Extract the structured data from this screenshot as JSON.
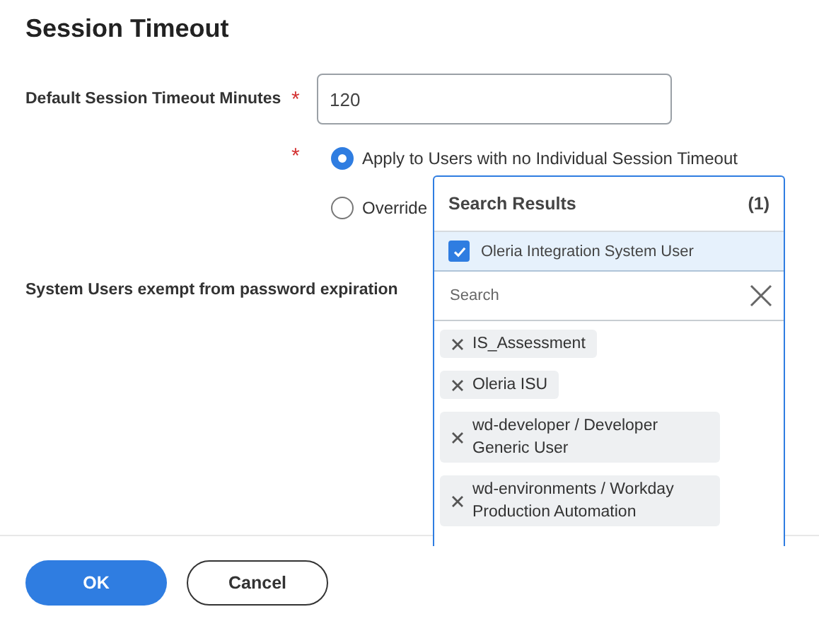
{
  "title": "Session Timeout",
  "timeout_field": {
    "label": "Default Session Timeout Minutes",
    "required_mark": "*",
    "value": "120"
  },
  "apply_options": {
    "required_mark": "*",
    "options": [
      {
        "label": "Apply to Users with no Individual Session Timeout",
        "selected": true
      },
      {
        "label": "Override",
        "selected": false
      }
    ]
  },
  "exempt_field": {
    "label": "System Users exempt from password expiration"
  },
  "search_popup": {
    "header": "Search Results",
    "count": "(1)",
    "results": [
      {
        "label": "Oleria Integration System User",
        "checked": true
      }
    ],
    "search": {
      "placeholder": "Search"
    },
    "chips": [
      "IS_Assessment",
      "Oleria ISU",
      "wd-developer / Developer Generic User",
      "wd-environments / Workday Production Automation"
    ]
  },
  "buttons": [
    {
      "label": "OK",
      "kind": "primary"
    },
    {
      "label": "Cancel",
      "kind": "secondary"
    }
  ]
}
